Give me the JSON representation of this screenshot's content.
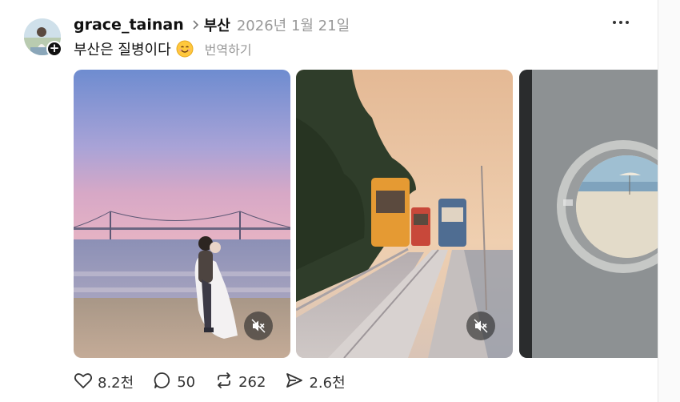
{
  "post": {
    "author": {
      "username": "grace_tainan"
    },
    "topic": "부산",
    "date": "2026년 1월 21일",
    "caption": "부산은 질병이다",
    "translate_label": "번역하기",
    "emoji": "smiling-face-emoji",
    "media": [
      {
        "kind": "video",
        "subject": "couple-embracing-on-beach-at-dusk",
        "muted": true
      },
      {
        "kind": "video",
        "subject": "sky-capsule-trams-at-sunset",
        "muted": true
      },
      {
        "kind": "image",
        "subject": "beach-through-round-window"
      }
    ],
    "stats": {
      "likes": "8.2천",
      "replies": "50",
      "reposts": "262",
      "shares": "2.6천"
    }
  },
  "icons": {
    "more": "more-horizontal-icon",
    "like": "heart-icon",
    "reply": "comment-bubble-icon",
    "repost": "repost-arrows-icon",
    "share": "send-icon",
    "mute": "speaker-muted-icon",
    "follow": "plus-icon",
    "topic_separator": "chevron-right-icon"
  },
  "colors": {
    "text_primary": "#101010",
    "text_secondary": "#999999",
    "background": "#ffffff"
  }
}
